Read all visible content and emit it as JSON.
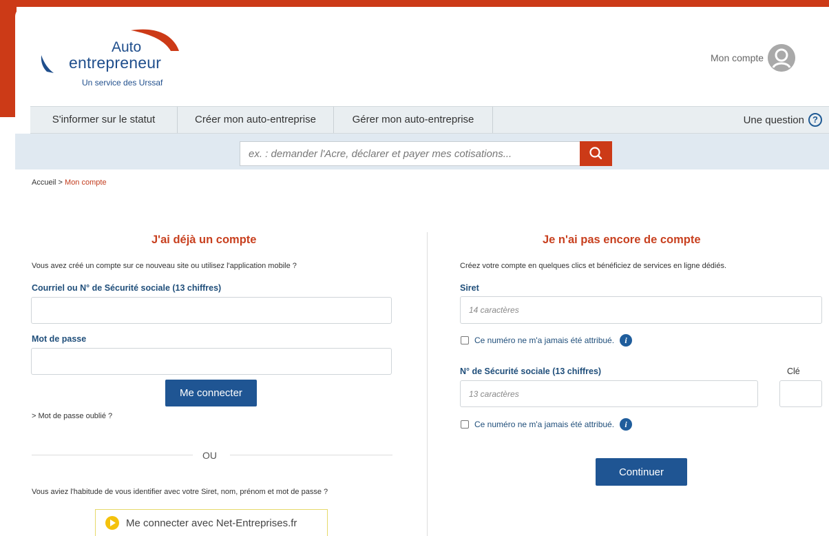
{
  "logo": {
    "line1": "Auto",
    "line2": "entrepreneur",
    "tagline": "Un service des Urssaf"
  },
  "account": {
    "label": "Mon compte"
  },
  "nav": {
    "items": [
      {
        "label": "S'informer sur le statut"
      },
      {
        "label": "Créer mon auto-entreprise"
      },
      {
        "label": "Gérer mon auto-entreprise"
      }
    ],
    "question": "Une question",
    "question_icon": "?"
  },
  "search": {
    "placeholder": "ex. : demander l'Acre, déclarer et payer mes cotisations..."
  },
  "breadcrumb": {
    "home": "Accueil",
    "separator": ">",
    "current": "Mon compte"
  },
  "login": {
    "title": "J'ai déjà un compte",
    "intro": "Vous avez créé un compte sur ce nouveau site ou utilisez l'application mobile ?",
    "email_label": "Courriel ou N° de Sécurité sociale (13 chiffres)",
    "email_value": "",
    "password_label": "Mot de passe",
    "password_value": "",
    "submit": "Me connecter",
    "forgot": "> Mot de passe oublié ?",
    "or": "OU",
    "legacy_text": "Vous aviez l'habitude de vous identifier avec votre Siret, nom, prénom et mot de passe ?",
    "netentreprises": "Me connecter avec Net-Entreprises.fr"
  },
  "signup": {
    "title": "Je n'ai pas encore de compte",
    "intro": "Créez votre compte en quelques clics et bénéficiez de services en ligne dédiés.",
    "siret_label": "Siret",
    "siret_placeholder": "14 caractères",
    "siret_check": "Ce numéro ne m'a jamais été attribué.",
    "nss_label": "N° de Sécurité sociale (13 chiffres)",
    "nss_placeholder": "13 caractères",
    "key_label": "Clé",
    "nss_check": "Ce numéro ne m'a jamais été attribué.",
    "info_icon": "i",
    "submit": "Continuer"
  },
  "colors": {
    "brand_red": "#cc3a17",
    "brand_blue": "#1f5593",
    "heading_red": "#c8401f"
  }
}
